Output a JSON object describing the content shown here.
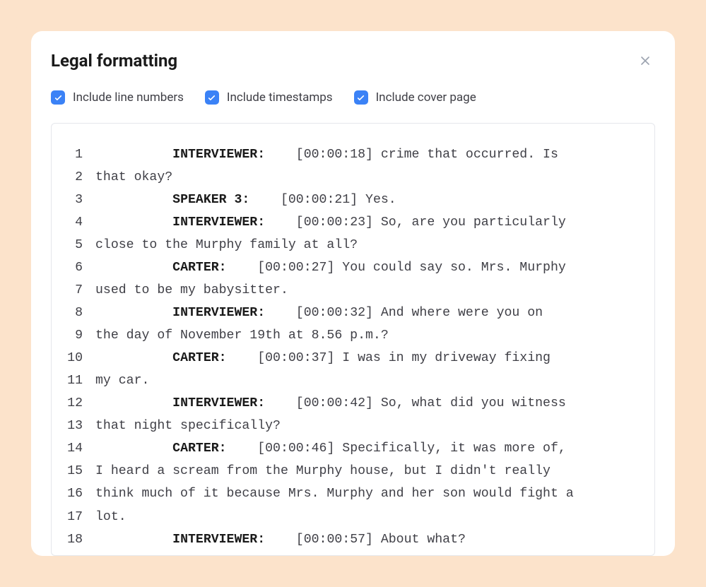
{
  "header": {
    "title": "Legal formatting"
  },
  "options": [
    {
      "label": "Include line numbers",
      "checked": true
    },
    {
      "label": "Include timestamps",
      "checked": true
    },
    {
      "label": "Include cover page",
      "checked": true
    }
  ],
  "transcript": [
    {
      "num": "1",
      "indent": "          ",
      "speaker": "INTERVIEWER:",
      "after": "    [00:00:18] crime that occurred. Is"
    },
    {
      "num": "2",
      "indent": "",
      "speaker": "",
      "after": "that okay?"
    },
    {
      "num": "3",
      "indent": "          ",
      "speaker": "SPEAKER 3:",
      "after": "    [00:00:21] Yes."
    },
    {
      "num": "4",
      "indent": "          ",
      "speaker": "INTERVIEWER:",
      "after": "    [00:00:23] So, are you particularly"
    },
    {
      "num": "5",
      "indent": "",
      "speaker": "",
      "after": "close to the Murphy family at all?"
    },
    {
      "num": "6",
      "indent": "          ",
      "speaker": "CARTER:",
      "after": "    [00:00:27] You could say so. Mrs. Murphy"
    },
    {
      "num": "7",
      "indent": "",
      "speaker": "",
      "after": "used to be my babysitter."
    },
    {
      "num": "8",
      "indent": "          ",
      "speaker": "INTERVIEWER:",
      "after": "    [00:00:32] And where were you on"
    },
    {
      "num": "9",
      "indent": "",
      "speaker": "",
      "after": "the day of November 19th at 8.56 p.m.?"
    },
    {
      "num": "10",
      "indent": "          ",
      "speaker": "CARTER:",
      "after": "    [00:00:37] I was in my driveway fixing"
    },
    {
      "num": "11",
      "indent": "",
      "speaker": "",
      "after": "my car."
    },
    {
      "num": "12",
      "indent": "          ",
      "speaker": "INTERVIEWER:",
      "after": "    [00:00:42] So, what did you witness"
    },
    {
      "num": "13",
      "indent": "",
      "speaker": "",
      "after": "that night specifically?"
    },
    {
      "num": "14",
      "indent": "          ",
      "speaker": "CARTER:",
      "after": "    [00:00:46] Specifically, it was more of,"
    },
    {
      "num": "15",
      "indent": "",
      "speaker": "",
      "after": "I heard a scream from the Murphy house, but I didn't really"
    },
    {
      "num": "16",
      "indent": "",
      "speaker": "",
      "after": "think much of it because Mrs. Murphy and her son would fight a"
    },
    {
      "num": "17",
      "indent": "",
      "speaker": "",
      "after": "lot."
    },
    {
      "num": "18",
      "indent": "          ",
      "speaker": "INTERVIEWER:",
      "after": "    [00:00:57] About what?"
    }
  ]
}
